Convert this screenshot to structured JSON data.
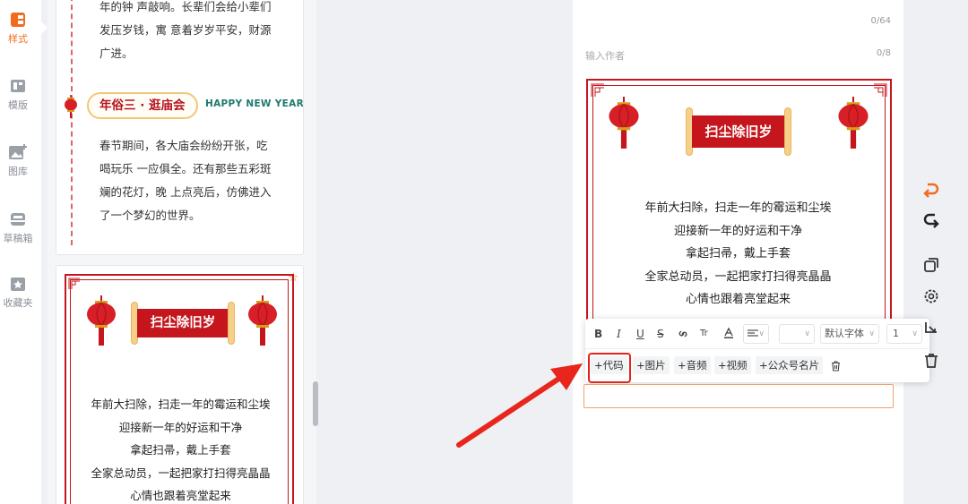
{
  "rail": {
    "items": [
      {
        "label": "样式",
        "icon": "style-icon",
        "active": true
      },
      {
        "label": "模版",
        "icon": "template-icon"
      },
      {
        "label": "图库",
        "icon": "image-library-icon"
      },
      {
        "label": "草稿箱",
        "icon": "drafts-icon"
      },
      {
        "label": "收藏夹",
        "icon": "favorites-icon"
      }
    ]
  },
  "list": {
    "card1": {
      "text_top": [
        "年的钟 声敲响。长辈们会给小辈们",
        "发压岁钱，寓 意着岁岁平安，财源",
        "广进。"
      ],
      "pill": "年俗三 · 逛庙会",
      "pill_en": "HAPPY NEW YEAR",
      "text_bottom": [
        "春节期间，各大庙会纷纷开张，吃",
        "喝玩乐 一应俱全。还有那些五彩斑",
        "斓的花灯，晚 上点亮后，仿佛进入",
        "了一个梦幻的世界。"
      ]
    },
    "card2": {
      "banner": "扫尘除旧岁",
      "poem": [
        "年前大扫除，扫走一年的霉运和尘埃",
        "迎接新一年的好运和干净",
        "拿起扫帚，戴上手套",
        "全家总动员，一起把家打扫得亮晶晶",
        "心情也跟着亮堂起来"
      ],
      "star": "☆"
    }
  },
  "editor": {
    "title_count": "0/64",
    "author_placeholder": "输入作者",
    "author_count": "0/8",
    "banner": "扫尘除旧岁",
    "poem": [
      "年前大扫除，扫走一年的霉运和尘埃",
      "迎接新一年的好运和干净",
      "拿起扫帚，戴上手套",
      "全家总动员，一起把家打扫得亮晶晶",
      "心情也跟着亮堂起来"
    ]
  },
  "toolbar": {
    "bold": "B",
    "italic": "I",
    "underline": "U",
    "strike": "S",
    "font_size_btn": "Tr",
    "font_family": "默认字体",
    "line_height": "1",
    "insert": [
      "+代码",
      "+图片",
      "+音频",
      "+视频",
      "+公众号名片"
    ]
  },
  "colors": {
    "accent": "#f26b1d",
    "festive_red": "#c4161c",
    "gold": "#f2c777",
    "highlight_red": "#e2231a"
  }
}
